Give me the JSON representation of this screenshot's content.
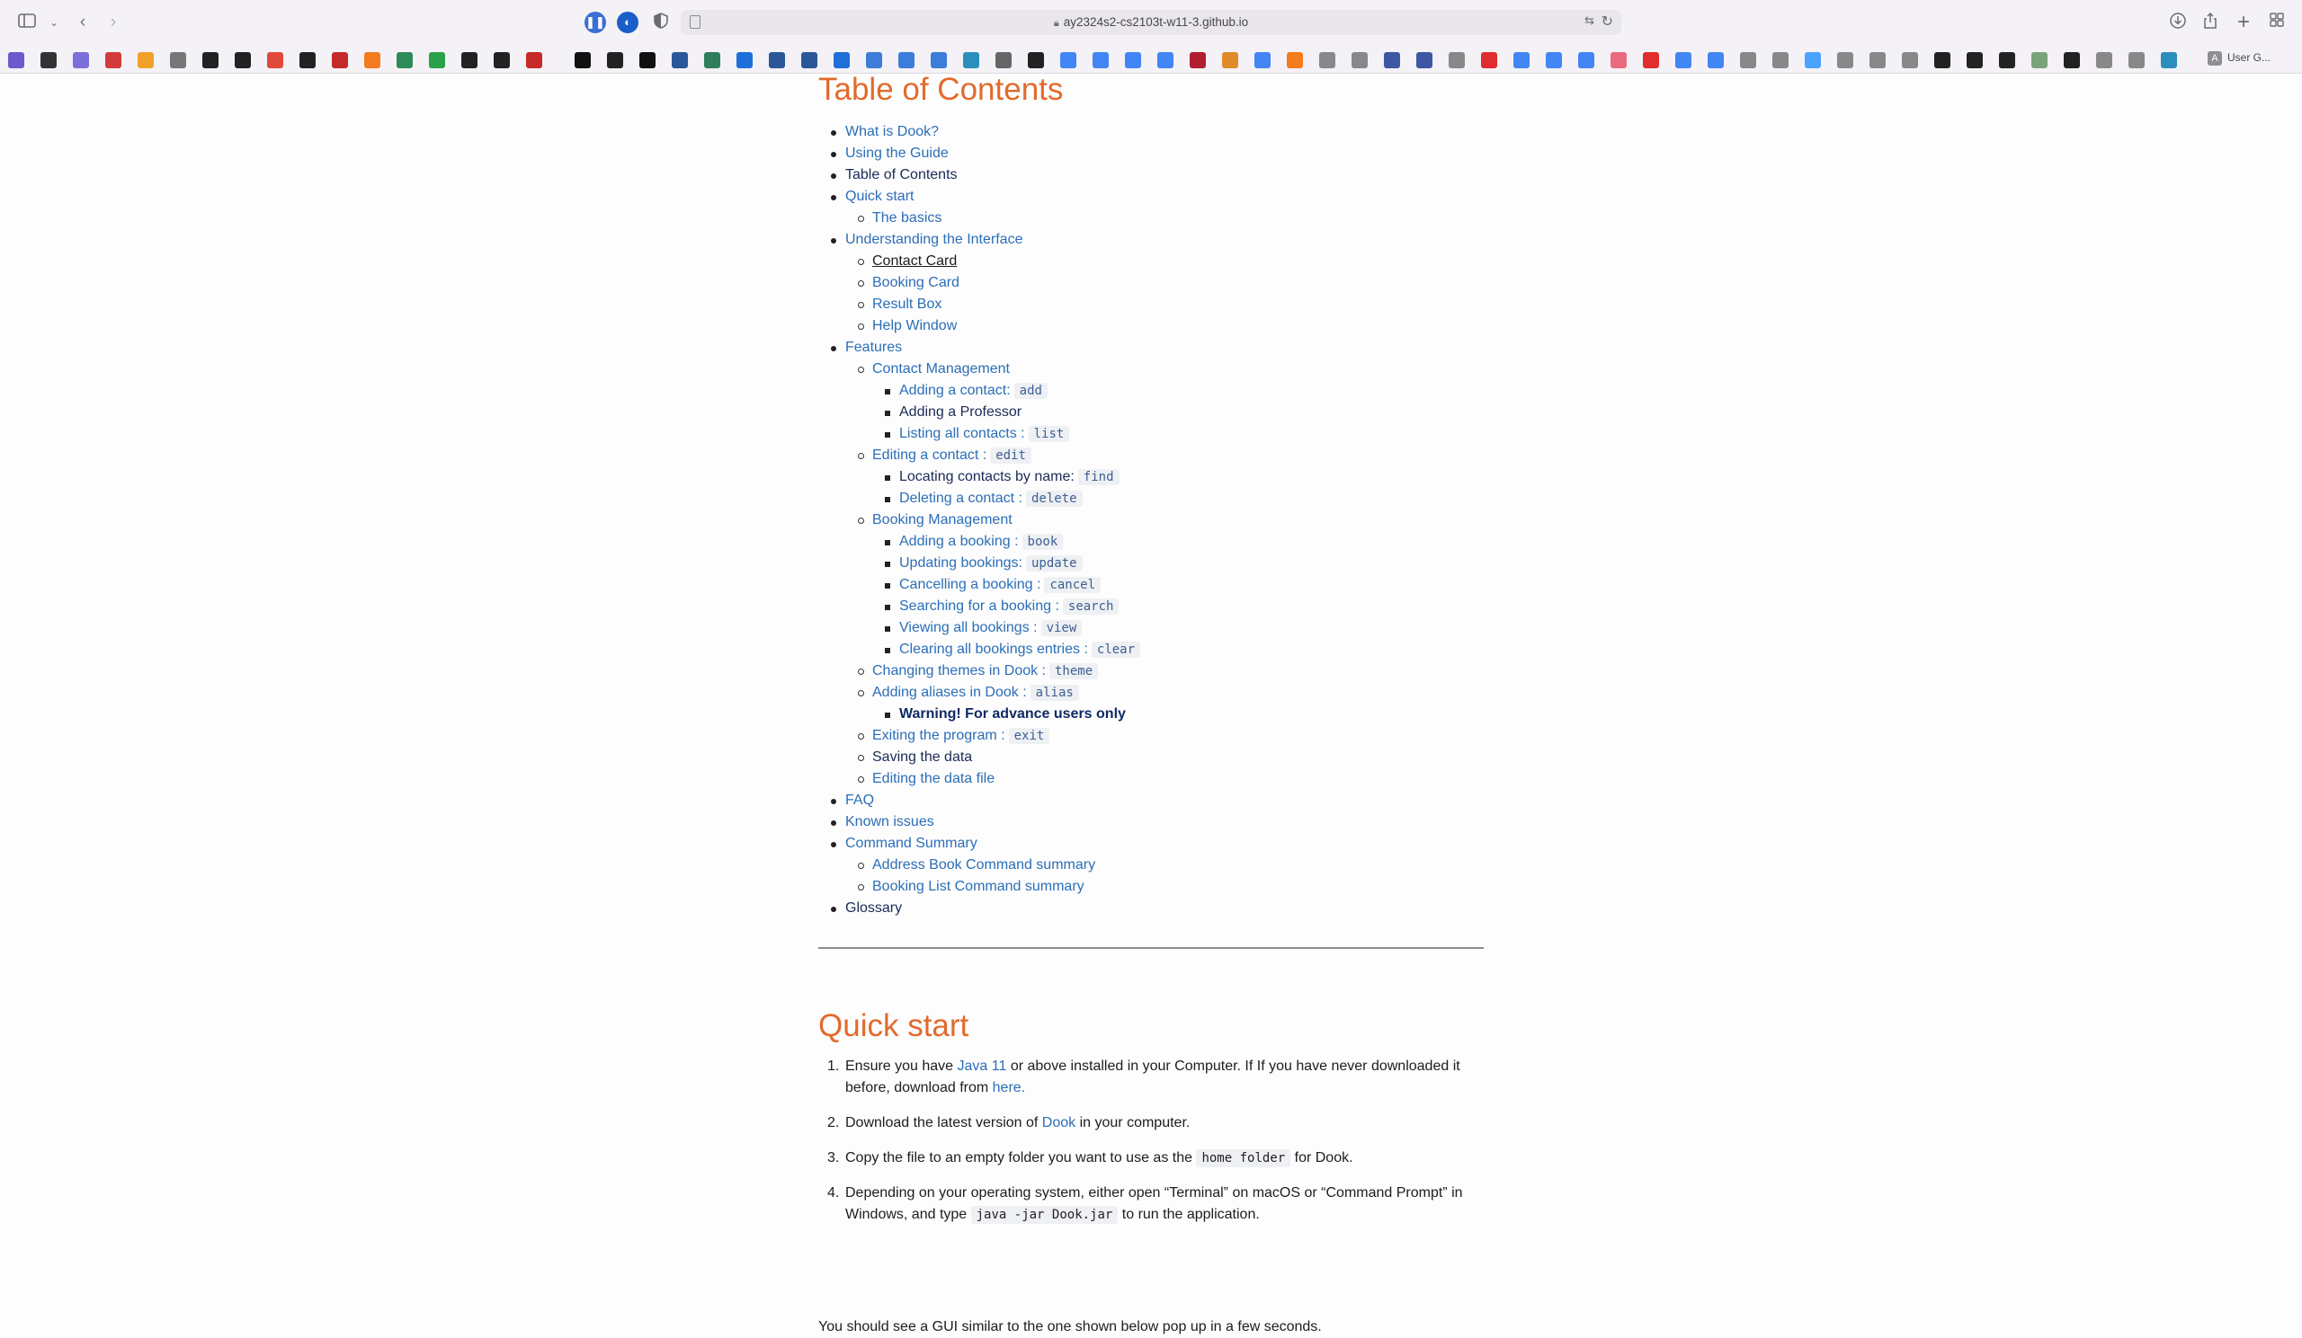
{
  "browser": {
    "url": "ay2324s2-cs2103t-w11-3.github.io",
    "bookmark_user_label": "User G...",
    "bookmark_user_initial": "A"
  },
  "toc": {
    "title": "Table of Contents",
    "items": [
      {
        "text": "What is Dook?",
        "level": 1,
        "style": "link"
      },
      {
        "text": "Using the Guide",
        "level": 1,
        "style": "link"
      },
      {
        "text": "Table of Contents",
        "level": 1,
        "style": "dark"
      },
      {
        "text": "Quick start",
        "level": 1,
        "style": "link"
      },
      {
        "text": "The basics",
        "level": 2,
        "style": "link"
      },
      {
        "text": "Understanding the Interface",
        "level": 1,
        "style": "link"
      },
      {
        "text": "Contact Card",
        "level": 2,
        "style": "underlined"
      },
      {
        "text": "Booking Card",
        "level": 2,
        "style": "link"
      },
      {
        "text": "Result Box",
        "level": 2,
        "style": "link"
      },
      {
        "text": "Help Window",
        "level": 2,
        "style": "link"
      },
      {
        "text": "Features",
        "level": 1,
        "style": "link"
      },
      {
        "text": "Contact Management",
        "level": 2,
        "style": "link"
      },
      {
        "text": "Adding a contact:",
        "code": "add",
        "level": 3,
        "style": "link"
      },
      {
        "text": "Adding a Professor",
        "level": 3,
        "style": "dark"
      },
      {
        "text": "Listing all contacts :",
        "code": "list",
        "level": 3,
        "style": "link"
      },
      {
        "text": "Editing a contact :",
        "code": "edit",
        "level": 2,
        "style": "link"
      },
      {
        "text": "Locating contacts by name:",
        "code": "find",
        "level": 3,
        "style": "dark"
      },
      {
        "text": "Deleting a contact :",
        "code": "delete",
        "level": 3,
        "style": "link"
      },
      {
        "text": "Booking Management",
        "level": 2,
        "style": "link"
      },
      {
        "text": "Adding a booking :",
        "code": "book",
        "level": 3,
        "style": "link"
      },
      {
        "text": "Updating bookings:",
        "code": "update",
        "level": 3,
        "style": "link"
      },
      {
        "text": "Cancelling a booking :",
        "code": "cancel",
        "level": 3,
        "style": "link"
      },
      {
        "text": "Searching for a booking :",
        "code": "search",
        "level": 3,
        "style": "link"
      },
      {
        "text": "Viewing all bookings :",
        "code": "view",
        "level": 3,
        "style": "link"
      },
      {
        "text": "Clearing all bookings entries :",
        "code": "clear",
        "level": 3,
        "style": "link"
      },
      {
        "text": "Changing themes in Dook :",
        "code": "theme",
        "level": 2,
        "style": "link"
      },
      {
        "text": "Adding aliases in Dook :",
        "code": "alias",
        "level": 2,
        "style": "link"
      },
      {
        "text": "Warning! For advance users only",
        "level": 3,
        "style": "bold"
      },
      {
        "text": "Exiting the program :",
        "code": "exit",
        "level": 2,
        "style": "link"
      },
      {
        "text": "Saving the data",
        "level": 2,
        "style": "dark"
      },
      {
        "text": "Editing the data file",
        "level": 2,
        "style": "link"
      },
      {
        "text": "FAQ",
        "level": 1,
        "style": "link"
      },
      {
        "text": "Known issues",
        "level": 1,
        "style": "link"
      },
      {
        "text": "Command Summary",
        "level": 1,
        "style": "link"
      },
      {
        "text": "Address Book Command summary",
        "level": 2,
        "style": "link"
      },
      {
        "text": "Booking List Command summary",
        "level": 2,
        "style": "link"
      },
      {
        "text": "Glossary",
        "level": 1,
        "style": "dark"
      }
    ]
  },
  "quick_start": {
    "title": "Quick start",
    "steps": [
      {
        "num": "1.",
        "parts": [
          {
            "t": "Ensure you have "
          },
          {
            "t": "Java 11",
            "link": true
          },
          {
            "t": " or above installed in your Computer. If If you have never downloaded it before, download from "
          },
          {
            "t": "here.",
            "link": true
          }
        ]
      },
      {
        "num": "2.",
        "parts": [
          {
            "t": "Download the latest version of "
          },
          {
            "t": "Dook",
            "link": true
          },
          {
            "t": " in your computer."
          }
        ]
      },
      {
        "num": "3.",
        "parts": [
          {
            "t": "Copy the file to an empty folder you want to use as the "
          },
          {
            "t": "home folder",
            "code": true
          },
          {
            "t": " for Dook."
          }
        ]
      },
      {
        "num": "4.",
        "parts": [
          {
            "t": "Depending on your operating system, either open “Terminal” on macOS or “Command Prompt” in Windows, and type "
          },
          {
            "t": "java -jar Dook.jar",
            "code": true
          },
          {
            "t": " to run the application."
          }
        ]
      }
    ],
    "after_text": "You should see a GUI similar to the one shown below pop up in a few seconds."
  },
  "colors": {
    "heading": "#e26a2c",
    "link": "#2b6eb8",
    "dark_link": "#1b2b55"
  }
}
